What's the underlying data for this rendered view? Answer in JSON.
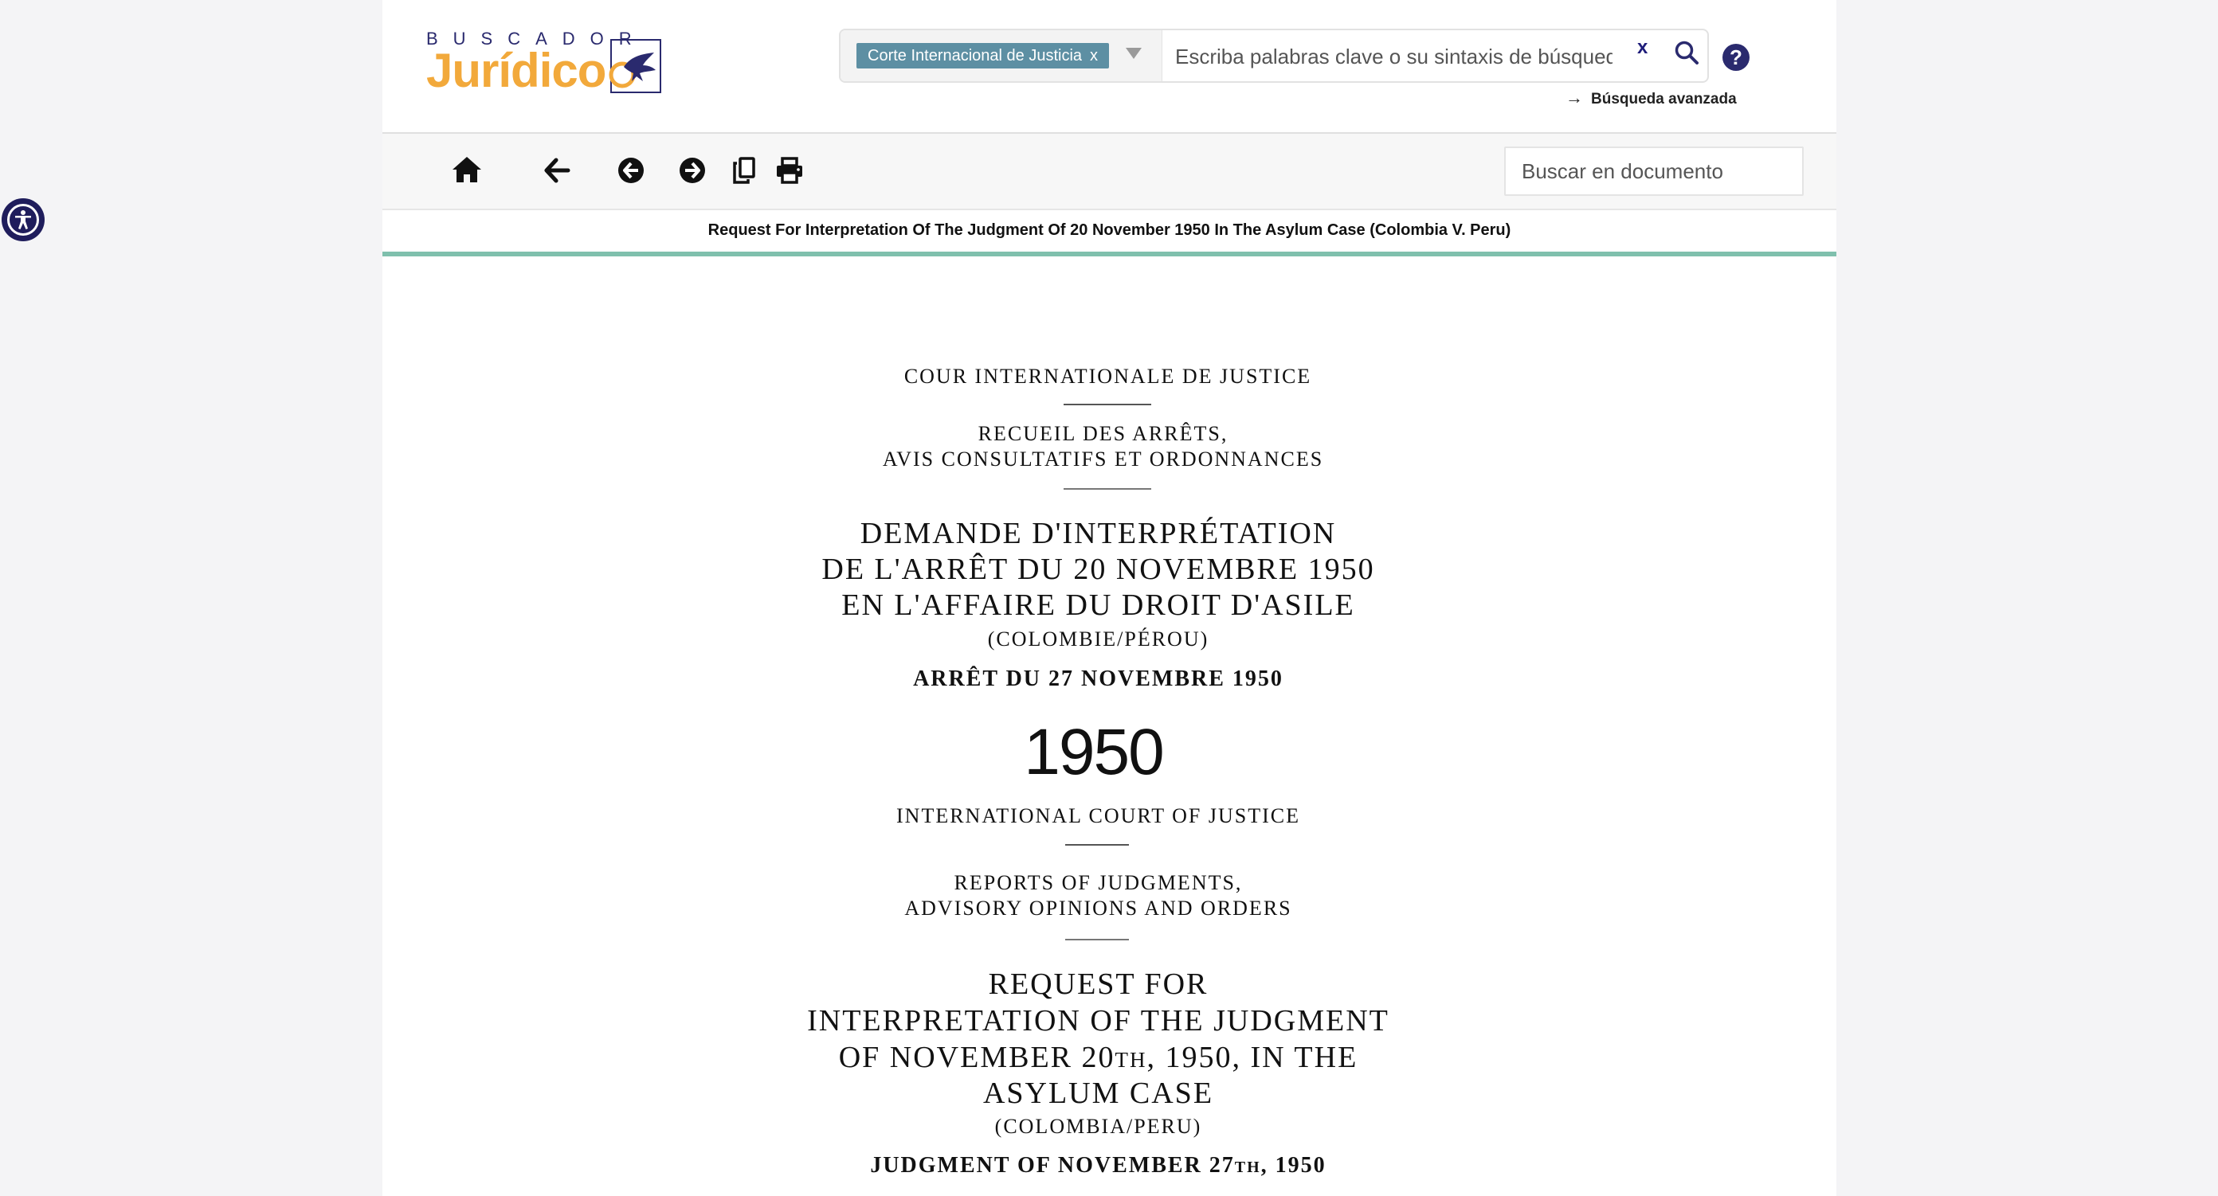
{
  "accessibility": {
    "icon": "accessibility-icon"
  },
  "header": {
    "logo_top": "BUSCADOR",
    "logo_main": "Jurídico",
    "logo_icon": "eagle-emblem-icon",
    "filter_chip": "Corte Internacional de Justicia",
    "filter_chip_remove": "x",
    "search_placeholder": "Escriba palabras clave o su sintaxis de búsqued",
    "search_clear": "x",
    "help": "?",
    "advanced_arrow": "→",
    "advanced_search": "Búsqueda avanzada"
  },
  "toolbar": {
    "icons": [
      "home-icon",
      "back-arrow-icon",
      "previous-circle-icon",
      "next-circle-icon",
      "copy-icon",
      "print-icon"
    ],
    "doc_search_placeholder": "Buscar en documento"
  },
  "document_title": "Request For Interpretation Of The Judgment Of 20 November 1950 In The Asylum Case (Colombia V. Peru)",
  "document": {
    "fr_court": "COUR INTERNATIONALE DE JUSTICE",
    "fr_reports_1": "RECUEIL DES ARRÊTS,",
    "fr_reports_2": "AVIS CONSULTATIFS ET ORDONNANCES",
    "fr_title_1": "DEMANDE D'INTERPRÉTATION",
    "fr_title_2": "DE L'ARRÊT DU 20 NOVEMBRE 1950",
    "fr_title_3": "EN L'AFFAIRE DU DROIT D'ASILE",
    "fr_parties": "(COLOMBIE/PÉROU)",
    "fr_judgment": "ARRÊT DU 27 NOVEMBRE 1950",
    "year": "1950",
    "en_court": "INTERNATIONAL COURT OF JUSTICE",
    "en_reports_1": "REPORTS OF JUDGMENTS,",
    "en_reports_2": "ADVISORY OPINIONS AND ORDERS",
    "en_title_1": "REQUEST FOR",
    "en_title_2": "INTERPRETATION OF THE JUDGMENT",
    "en_title_3": "OF NOVEMBER 20th, 1950, IN THE",
    "en_title_4": "ASYLUM CASE",
    "en_parties": "(COLOMBIA/PERU)",
    "en_judgment": "JUDGMENT OF NOVEMBER 27th, 1950"
  }
}
